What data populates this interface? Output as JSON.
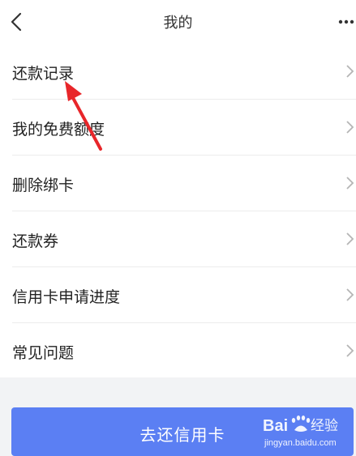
{
  "nav": {
    "title": "我的",
    "back_icon": "chevron-left-icon",
    "more_icon": "more-dots-icon"
  },
  "menu": {
    "items": [
      {
        "label": "还款记录"
      },
      {
        "label": "我的免费额度"
      },
      {
        "label": "删除绑卡"
      },
      {
        "label": "还款券"
      },
      {
        "label": "信用卡申请进度"
      },
      {
        "label": "常见问题"
      }
    ]
  },
  "cta": {
    "label": "去还信用卡"
  },
  "watermark": {
    "brand": "Baidu经验",
    "url": "jingyan.baidu.com"
  },
  "colors": {
    "accent": "#5b7ff3",
    "annotation_arrow": "#e8262a",
    "background": "#f2f3f5"
  }
}
